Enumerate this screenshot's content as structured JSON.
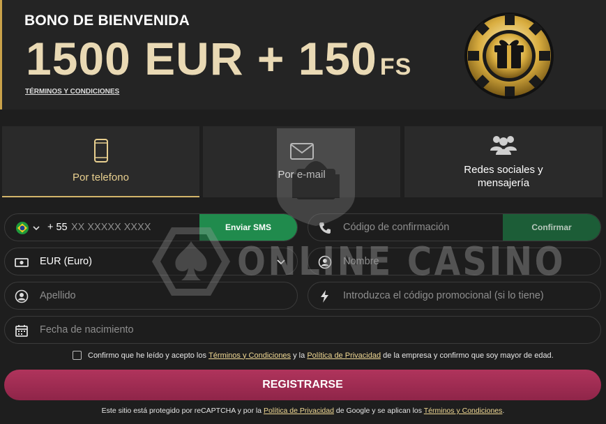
{
  "banner": {
    "title": "BONO DE BIENVENIDA",
    "amount": "1500 EUR + 150",
    "amount_suffix": "FS",
    "terms_link": "TÉRMINOS Y CONDICIONES"
  },
  "tabs": [
    {
      "label": "Por telefono",
      "icon": "phone-icon",
      "active": true
    },
    {
      "label": "Por e-mail",
      "icon": "mail-icon",
      "active": false
    },
    {
      "label": "Redes sociales y mensajería",
      "icon": "users-icon",
      "active": false
    }
  ],
  "form": {
    "phone_prefix": "+ 55",
    "phone_placeholder": "XX XXXXX XXXX",
    "send_sms": "Enviar SMS",
    "confirmation_placeholder": "Código de confirmación",
    "confirm": "Confirmar",
    "currency_value": "EUR (Euro)",
    "first_name_placeholder": "Nombre",
    "last_name_placeholder": "Apellido",
    "promo_placeholder": "Introduzca el código promocional (si lo tiene)",
    "birthdate_placeholder": "Fecha de nacimiento"
  },
  "consent": {
    "text_1": "Confirmo que he leído y acepto los",
    "link_terms": "Términos y Condiciones",
    "text_2": "y la",
    "link_privacy": "Política de Privacidad",
    "text_3": "de la empresa y confirmo que soy mayor de edad."
  },
  "register_label": "REGISTRARSE",
  "recaptcha": {
    "text_1": "Este sitio está protegido por reCAPTCHA y por la",
    "link_privacy": "Política de Privacidad",
    "text_2": "de Google y se aplican los",
    "link_terms": "Términos y Condiciones",
    "text_3": "."
  },
  "watermark": {
    "text": "ONLINE CASINO"
  },
  "colors": {
    "accent_gold": "#d4b56b",
    "green": "#1f8a4c",
    "dark_green": "#1c5e36",
    "register": "#a3305a"
  }
}
